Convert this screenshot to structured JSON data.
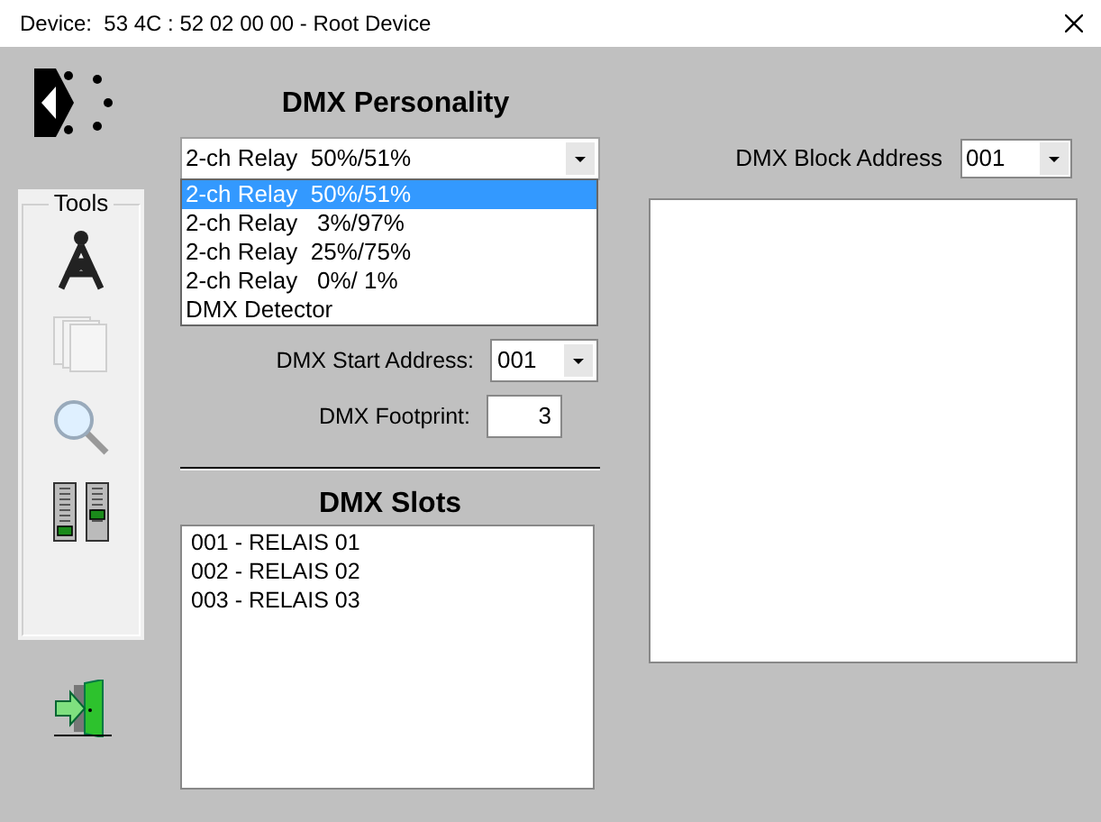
{
  "window": {
    "title": "Device:  53 4C : 52 02 00 00 - Root Device"
  },
  "tools": {
    "label": "Tools",
    "items": [
      {
        "kind": "tower",
        "disabled": false
      },
      {
        "kind": "pages",
        "disabled": true
      },
      {
        "kind": "search",
        "disabled": false
      },
      {
        "kind": "faders",
        "disabled": false
      }
    ]
  },
  "personality": {
    "title": "DMX Personality",
    "value": "2-ch Relay  50%/51%",
    "expanded": true,
    "options": [
      {
        "label": "2-ch Relay  50%/51%",
        "selected": true
      },
      {
        "label": "2-ch Relay   3%/97%",
        "selected": false
      },
      {
        "label": "2-ch Relay  25%/75%",
        "selected": false
      },
      {
        "label": "2-ch Relay   0%/ 1%",
        "selected": false
      },
      {
        "label": "DMX Detector",
        "selected": false
      }
    ]
  },
  "start_address": {
    "label": "DMX Start Address:",
    "value": "001"
  },
  "footprint": {
    "label": "DMX Footprint:",
    "value": "3"
  },
  "slots": {
    "title": "DMX Slots",
    "items": [
      "001 - RELAIS 01",
      "002 - RELAIS 02",
      "003 - RELAIS 03"
    ]
  },
  "block_address": {
    "label": "DMX Block Address",
    "value": "001"
  }
}
